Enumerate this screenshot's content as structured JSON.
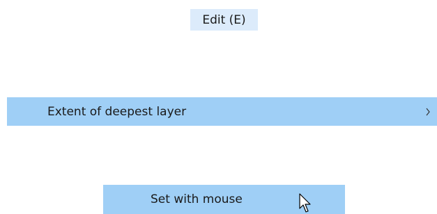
{
  "menu": {
    "title": "Edit (E)"
  },
  "submenu": {
    "label": "Extent of deepest layer",
    "chevron_icon": "chevron-right-icon"
  },
  "command": {
    "label": "Set with mouse"
  },
  "cursor": {
    "icon": "mouse-pointer-icon"
  },
  "colors": {
    "menu_hover_bg": "#dcebfb",
    "selected_bg": "#9fcff6",
    "text": "#1a1a1a"
  }
}
